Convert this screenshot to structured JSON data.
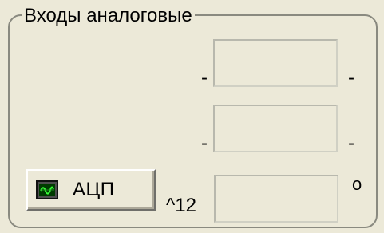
{
  "group": {
    "title": "Входы аналоговые"
  },
  "rows": [
    {
      "prefix": "-",
      "value": "",
      "suffix": "-"
    },
    {
      "prefix": "-",
      "value": "",
      "suffix": "-"
    },
    {
      "prefix": "^12",
      "value": "",
      "suffix": "o"
    }
  ],
  "button": {
    "label": "АЦП",
    "icon": "waveform-icon"
  }
}
